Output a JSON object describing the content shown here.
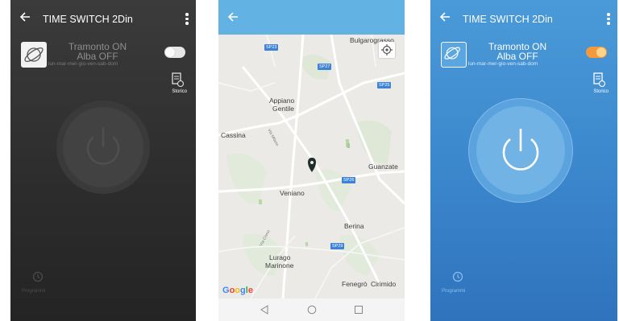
{
  "screens": {
    "app_dark": {
      "title": "TIME SWITCH 2Din",
      "device_line1": "Tramonto ON",
      "device_line2": "Alba OFF",
      "days": "lun-mar-mer-gio-ven-sab-dom",
      "toggle_on": false,
      "history_label": "Storico",
      "programs_label": "Programmi"
    },
    "map": {
      "places": [
        "Bulgarograsso",
        "Appiano",
        "Gentile",
        "Cassina",
        "Guanzate",
        "Veniano",
        "Berina",
        "Lurago",
        "Marinone",
        "Fenegrò",
        "Cirimido"
      ],
      "road_badges": [
        "SP23",
        "SP27",
        "SP25",
        "SP26",
        "SP29"
      ],
      "road_names": [
        "Via Milano",
        "Via Como"
      ],
      "attribution": "Google"
    },
    "app_blue": {
      "title": "TIME SWITCH 2Din",
      "device_line1": "Tramonto ON",
      "device_line2": "Alba OFF",
      "days": "lun-mar-mer-gio-ven-sab-dom",
      "toggle_on": true,
      "history_label": "Storico",
      "programs_label": "Programmi"
    }
  },
  "colors": {
    "dark_bg": "#333333",
    "blue_bg": "#3d88ce",
    "map_header": "#62b2e4",
    "toggle_on": "#f39a3c",
    "road_badge": "#3d82d6",
    "pin": "#1f2f2b"
  }
}
